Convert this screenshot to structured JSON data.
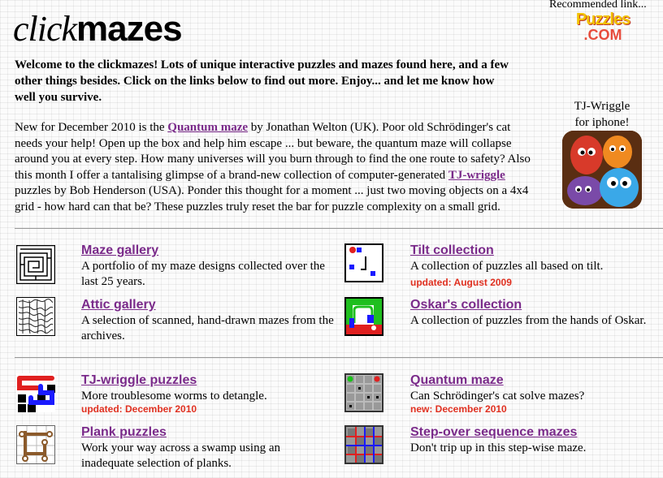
{
  "logo": {
    "part1": "click",
    "part2": "mazes"
  },
  "recommended": {
    "label": "Recommended link...",
    "line1": "Puzzles",
    "line2": ".COM"
  },
  "intro": "Welcome to the clickmazes! Lots of unique interactive puzzles and mazes found here, and a few other things besides. Click on the links below to find out more. Enjoy... and let me know how well you survive.",
  "news": {
    "t1": "New for December 2010 is the ",
    "link1": "Quantum maze",
    "t2": " by Jonathan Welton (UK). Poor old Schrödinger's cat needs your help! Open up the box and help him escape ... but beware, the quantum maze will collapse around you at every step. How many universes will you burn through to find the one route to safety? Also this month I offer a tantalising glimpse of a brand-new collection of computer-generated ",
    "link2": "TJ-wriggle",
    "t3": " puzzles by Bob Henderson (USA). Ponder this thought for a moment ... just two moving objects on a 4x4 grid - how hard can that be? These puzzles truly reset the bar for puzzle complexity on a small grid."
  },
  "iphone": {
    "line1": "TJ-Wriggle",
    "line2": "for iphone!"
  },
  "items": [
    {
      "title": "Maze gallery",
      "desc": "A portfolio of my maze designs collected over the last 25 years.",
      "update": ""
    },
    {
      "title": "Tilt collection",
      "desc": "A collection of puzzles all based on tilt.",
      "update": "updated: August 2009"
    },
    {
      "title": "Attic gallery",
      "desc": "A selection of scanned, hand-drawn mazes from the archives.",
      "update": ""
    },
    {
      "title": "Oskar's collection",
      "desc": "A collection of puzzles from the hands of Oskar.",
      "update": ""
    },
    {
      "title": "TJ-wriggle puzzles",
      "desc": "More troublesome worms to detangle.",
      "update": "updated: December 2010"
    },
    {
      "title": "Quantum maze",
      "desc": "Can Schrödinger's cat solve mazes?",
      "update": "new: December 2010"
    },
    {
      "title": "Plank puzzles",
      "desc": "Work your way across a swamp using an inadequate selection of planks.",
      "update": ""
    },
    {
      "title": "Step-over sequence mazes",
      "desc": "Don't trip up in this step-wise maze.",
      "update": ""
    }
  ],
  "colors": {
    "link": "#7a2a8a",
    "update": "#e03020"
  }
}
